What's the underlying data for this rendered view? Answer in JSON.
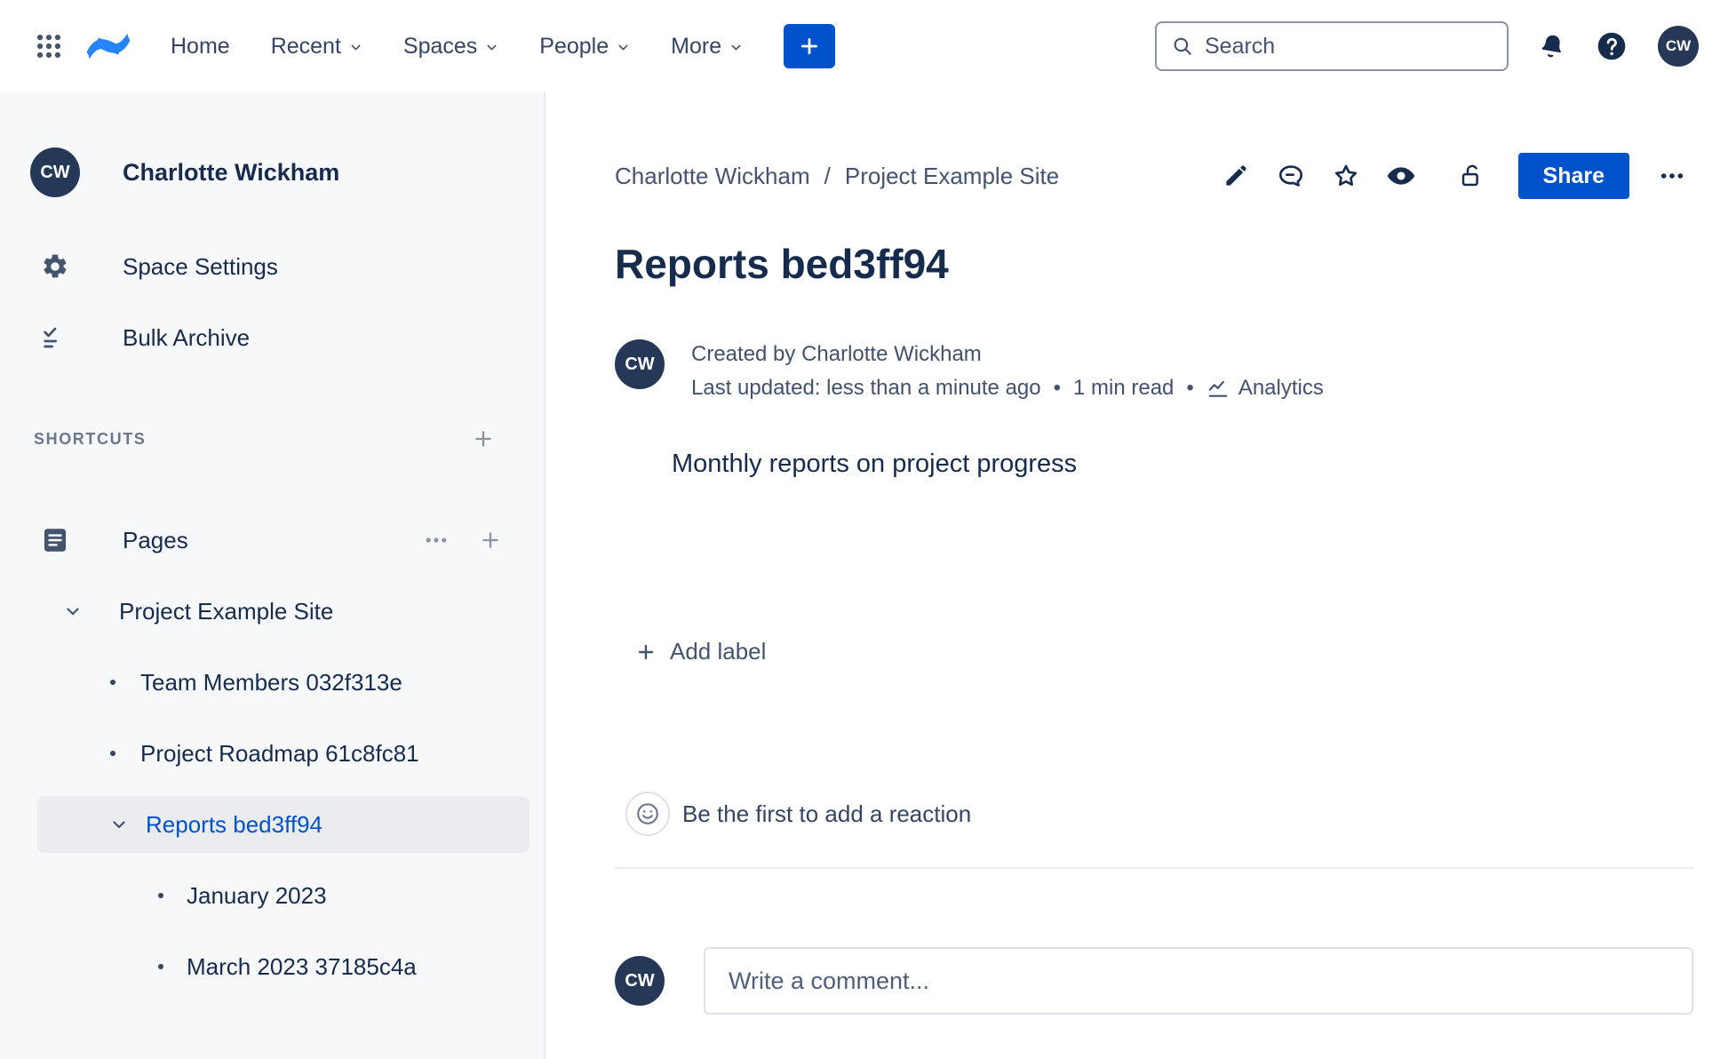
{
  "colors": {
    "brand_blue": "#0052CC",
    "logo_blue": "#2684FF",
    "avatar_navy": "#253858",
    "selected_item_bg": "#EBECF0",
    "selected_item_text": "#0052CC",
    "sidebar_bg": "#F7F8F9"
  },
  "topbar": {
    "icons": [
      "app-switcher",
      "confluence-logo",
      "search",
      "notifications-bell",
      "help",
      "user-avatar"
    ],
    "nav_items": [
      {
        "label": "Home",
        "chevron": false
      },
      {
        "label": "Recent",
        "chevron": true
      },
      {
        "label": "Spaces",
        "chevron": true
      },
      {
        "label": "People",
        "chevron": true
      },
      {
        "label": "More",
        "chevron": true
      }
    ],
    "search_placeholder": "Search",
    "avatar_initials": "CW"
  },
  "sidebar": {
    "space_avatar_initials": "CW",
    "space_name": "Charlotte Wickham",
    "space_settings_label": "Space Settings",
    "bulk_archive_label": "Bulk Archive",
    "shortcuts_header": "SHORTCUTS",
    "pages_label": "Pages",
    "tree": {
      "root_label": "Project Example Site",
      "items": [
        {
          "label": "Team Members 032f313e",
          "selected": false
        },
        {
          "label": "Project Roadmap 61c8fc81",
          "selected": false
        },
        {
          "label": "Reports bed3ff94",
          "selected": true
        },
        {
          "label": "January 2023",
          "selected": false
        },
        {
          "label": "March 2023 37185c4a",
          "selected": false
        }
      ]
    }
  },
  "main": {
    "breadcrumb": {
      "crumb1": "Charlotte Wickham",
      "separator": "/",
      "crumb2": "Project Example Site"
    },
    "header_action_icons": [
      "edit-pencil",
      "comment-bubble",
      "star",
      "watch-eye",
      "unlocked-padlock",
      "share",
      "more-ellipsis"
    ],
    "share_label": "Share",
    "title": "Reports bed3ff94",
    "byline": {
      "avatar_initials": "CW",
      "created_line": "Created by Charlotte Wickham",
      "updated_text": "Last updated: less than a minute ago",
      "separator": "•",
      "read_time": "1 min read",
      "analytics_label": "Analytics"
    },
    "body_text": "Monthly reports on project progress",
    "add_label_text": "Add label",
    "reaction_text": "Be the first to add a reaction",
    "comment_avatar_initials": "CW",
    "comment_placeholder": "Write a comment..."
  }
}
